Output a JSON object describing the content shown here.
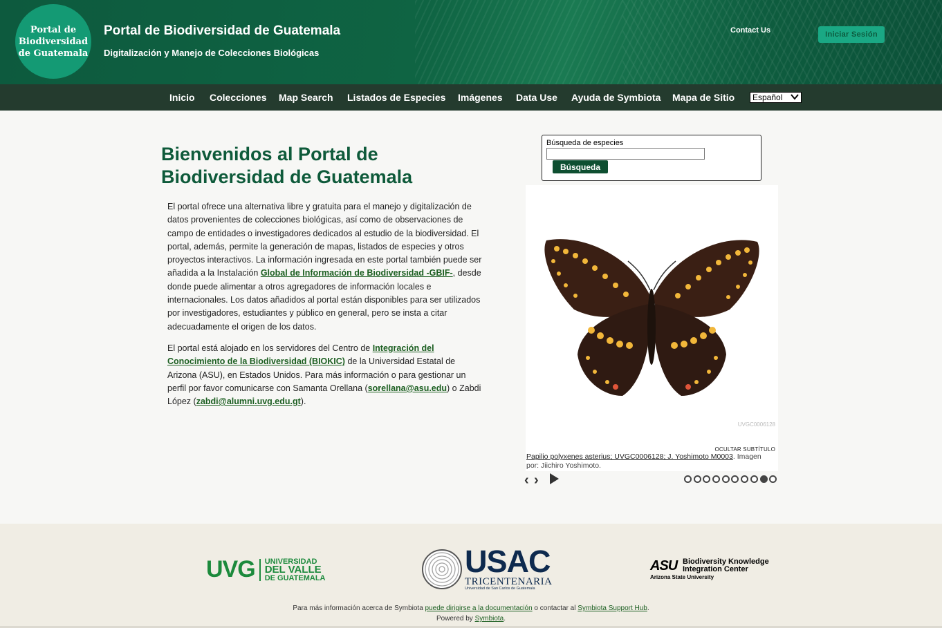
{
  "header": {
    "logo_lines": [
      "Portal de",
      "Biodiversidad",
      "de Guatemala"
    ],
    "title": "Portal de Biodiversidad de Guatemala",
    "subtitle": "Digitalización y Manejo de Colecciones Biológicas",
    "contact_label": "Contact Us",
    "login_label": "Iniciar Sesión"
  },
  "nav": {
    "items": [
      "Inicio",
      "Colecciones",
      "Map Search",
      "Listados de Especies",
      "Imágenes",
      "Data Use",
      "Ayuda de Symbiota",
      "Mapa de Sitio"
    ],
    "language": "Español"
  },
  "main": {
    "heading": "Bienvenidos al Portal de Biodiversidad de Guatemala",
    "para1_a": "El portal ofrece una alternativa libre y gratuita para el manejo y digitalización de datos provenientes de colecciones biológicas, así como de observaciones de campo de entidades o investigadores dedicados al estudio de la biodiversidad. El portal, además, permite la generación de mapas, listados de especies y otros proyectos interactivos. La información ingresada en este portal también puede ser añadida a la Instalación ",
    "para1_link": "Global de Información de Biodiversidad -GBIF-",
    "para1_b": ", desde donde puede alimentar a otros agregadores de información locales e internacionales. Los datos añadidos al portal están disponibles para ser utilizados por investigadores, estudiantes y público en general, pero se insta a citar adecuadamente el origen de los datos.",
    "para2_a": "El portal está alojado en los servidores del Centro de ",
    "para2_link1": "Integración del Conocimiento de la Biodiversidad (BIOKIC)",
    "para2_b": " de la Universidad Estatal de Arizona (ASU), en Estados Unidos. Para más información o para gestionar un perfil por favor comunicarse con Samanta Orellana (",
    "para2_link2": "sorellana@asu.edu",
    "para2_c": ") o Zabdi López (",
    "para2_link3": "zabdi@alumni.uvg.edu.gt",
    "para2_d": ")."
  },
  "search": {
    "label": "Búsqueda de especies",
    "value": "",
    "button": "Búsqueda"
  },
  "slideshow": {
    "hide_caption": "OCULTAR SUBTÍTULO",
    "caption_link": "Papilio polyxenes asterius; UVGC0006128; J. Yoshimoto M0003",
    "caption_rest": ". Imagen por: Jiichiro Yoshimoto.",
    "prev_icon": "‹",
    "next_icon": "›",
    "total_slides": 10,
    "active_slide": 9
  },
  "footer": {
    "uvg_abbr": "UVG",
    "uvg_line1": "UNIVERSIDAD",
    "uvg_line2": "DEL VALLE",
    "uvg_line3": "DE GUATEMALA",
    "usac": "USAC",
    "usac_sub": "TRICENTENARIA",
    "usac_sub2": "Universidad de San Carlos de Guatemala",
    "asu_mark": "ASU",
    "asu_title1": "Biodiversity Knowledge",
    "asu_title2": "Integration Center",
    "asu_sub": "Arizona State University",
    "info_a": "Para más información acerca de Symbiota ",
    "info_link1": "puede dirigirse a la documentación",
    "info_b": " o contactar al ",
    "info_link2": "Symbiota Support Hub",
    "info_c": ".",
    "powered_a": "Powered by ",
    "powered_link": "Symbiota",
    "powered_b": "."
  }
}
